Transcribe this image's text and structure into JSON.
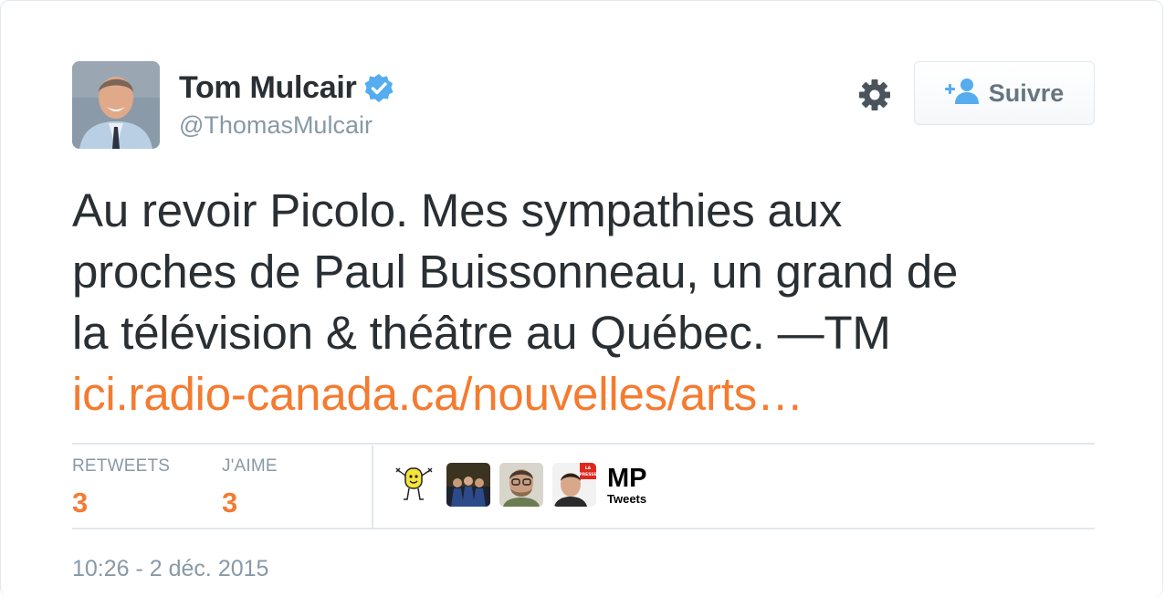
{
  "author": {
    "name": "Tom Mulcair",
    "handle": "@ThomasMulcair",
    "verified_icon": "verified-badge-icon"
  },
  "actions": {
    "settings_icon": "gear-icon",
    "follow_label": "Suivre",
    "follow_icon": "add-user-icon"
  },
  "tweet": {
    "lines": [
      "Au revoir Picolo. Mes sympathies aux",
      "proches de Paul Buissonneau, un grand de",
      "la télévision & théâtre au Québec. —TM"
    ],
    "link": "ici.radio-canada.ca/nouvelles/arts…"
  },
  "stats": {
    "retweets_label": "RETWEETS",
    "retweets_value": "3",
    "likes_label": "J'AIME",
    "likes_value": "3"
  },
  "likers": {
    "mp_big": "MP",
    "mp_small": "Tweets",
    "la_presse_text": "LA PRESSE"
  },
  "timestamp": "10:26 - 2 déc. 2015",
  "colors": {
    "accent": "#f47b30",
    "verified": "#55acee",
    "muted": "#8899a6",
    "text": "#292f33"
  }
}
